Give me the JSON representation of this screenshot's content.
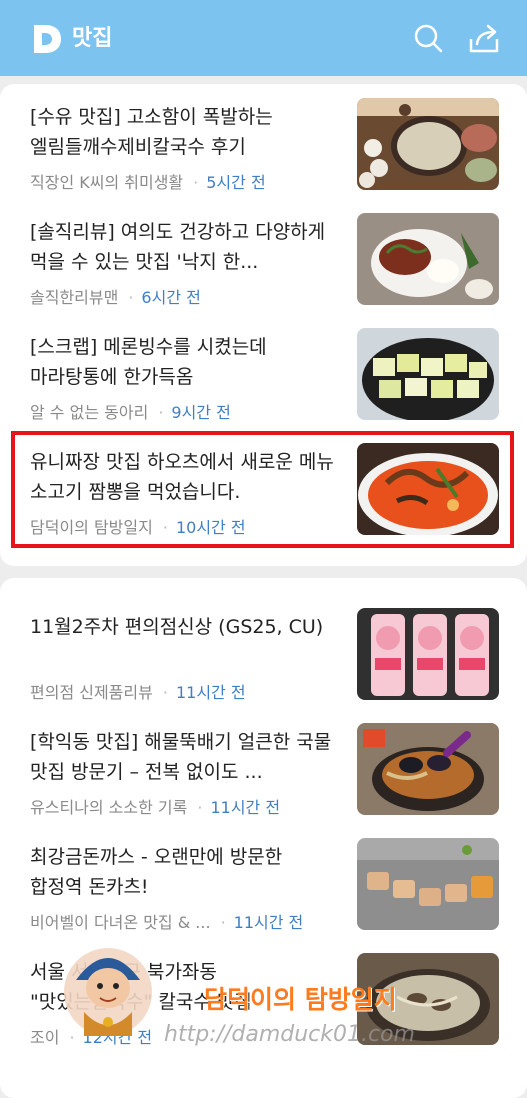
{
  "header": {
    "title": "맛집",
    "logo_letter": "D"
  },
  "section1": [
    {
      "title": "[수유 맛집] 고소함이 폭발하는 엘림들깨수제비칼국수 후기",
      "source": "직장인 K씨의 취미생활",
      "time": "5시간 전"
    },
    {
      "title": "[솔직리뷰] 여의도 건강하고 다양하게 먹을 수 있는 맛집 '낙지 한...",
      "source": "솔직한리뷰맨",
      "time": "6시간 전"
    },
    {
      "title": "[스크랩] 메론빙수를 시켰는데 마라탕통에 한가득옴",
      "source": "알 수 없는 동아리",
      "time": "9시간 전"
    },
    {
      "title": "유니짜장 맛집 하오츠에서 새로운 메뉴 소고기 짬뽕을 먹었습니다.",
      "source": "담덕이의 탐방일지",
      "time": "10시간 전"
    }
  ],
  "section2": [
    {
      "title": "11월2주차 편의점신상 (GS25, CU)",
      "source": "편의점 신제품리뷰",
      "time": "11시간 전"
    },
    {
      "title": "[학익동 맛집] 해물뚝배기 얼큰한 국물 맛집 방문기 – 전복 없이도 ...",
      "source": "유스티나의 소소한 기록",
      "time": "11시간 전"
    },
    {
      "title": "최강금돈까스 - 오랜만에 방문한 합정역 돈카츠!",
      "source": "비어벨이 다녀온 맛집 & ...",
      "time": "11시간 전"
    },
    {
      "title": "서울 서대문구 북가좌동 \"맛있는칼국수\" 칼국수 맛집",
      "source": "조이",
      "time": "12시간 전"
    }
  ],
  "watermark": {
    "name": "담덕이의 탐방일지",
    "url": "http://damduck01.com"
  },
  "colors": {
    "header": "#7cc4ef",
    "time": "#3f7fc5",
    "highlight": "#e8141b"
  }
}
